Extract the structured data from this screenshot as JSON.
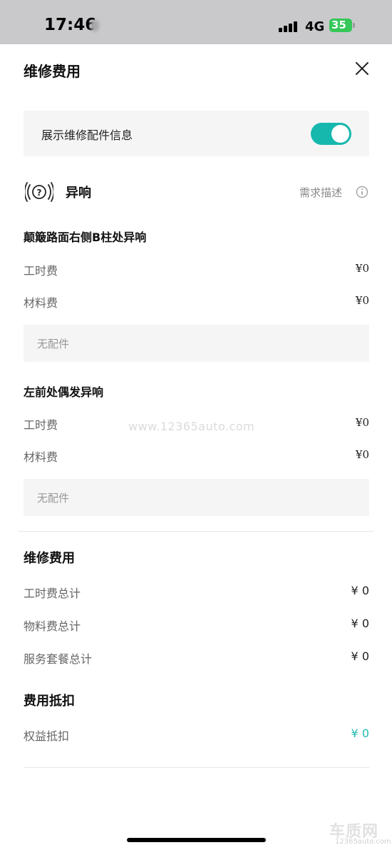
{
  "status_bar": {
    "time": "17:46",
    "network": "4G",
    "battery": "35"
  },
  "header": {
    "title": "维修费用"
  },
  "toggle": {
    "label": "展示维修配件信息",
    "on": true,
    "color": "#16b8ad"
  },
  "issue": {
    "title": "异响",
    "demand_link": "需求描述"
  },
  "items": [
    {
      "title": "颠簸路面右侧B柱处异响",
      "labor_label": "工时费",
      "labor_value": "¥0",
      "material_label": "材料费",
      "material_value": "¥0",
      "parts_text": "无配件"
    },
    {
      "title": "左前处偶发异响",
      "labor_label": "工时费",
      "labor_value": "¥0",
      "material_label": "材料费",
      "material_value": "¥0",
      "parts_text": "无配件"
    }
  ],
  "repair_cost": {
    "title": "维修费用",
    "rows": [
      {
        "label": "工时费总计",
        "value": "¥ 0"
      },
      {
        "label": "物料费总计",
        "value": "¥ 0"
      },
      {
        "label": "服务套餐总计",
        "value": "¥ 0"
      }
    ]
  },
  "deduction": {
    "title": "费用抵扣",
    "rows": [
      {
        "label": "权益抵扣",
        "value": "¥ 0",
        "color": "#1fbcb4"
      }
    ]
  },
  "watermark": "www.12365auto.com",
  "brand": {
    "logo": "车质网",
    "sub": "12365auto.com"
  }
}
